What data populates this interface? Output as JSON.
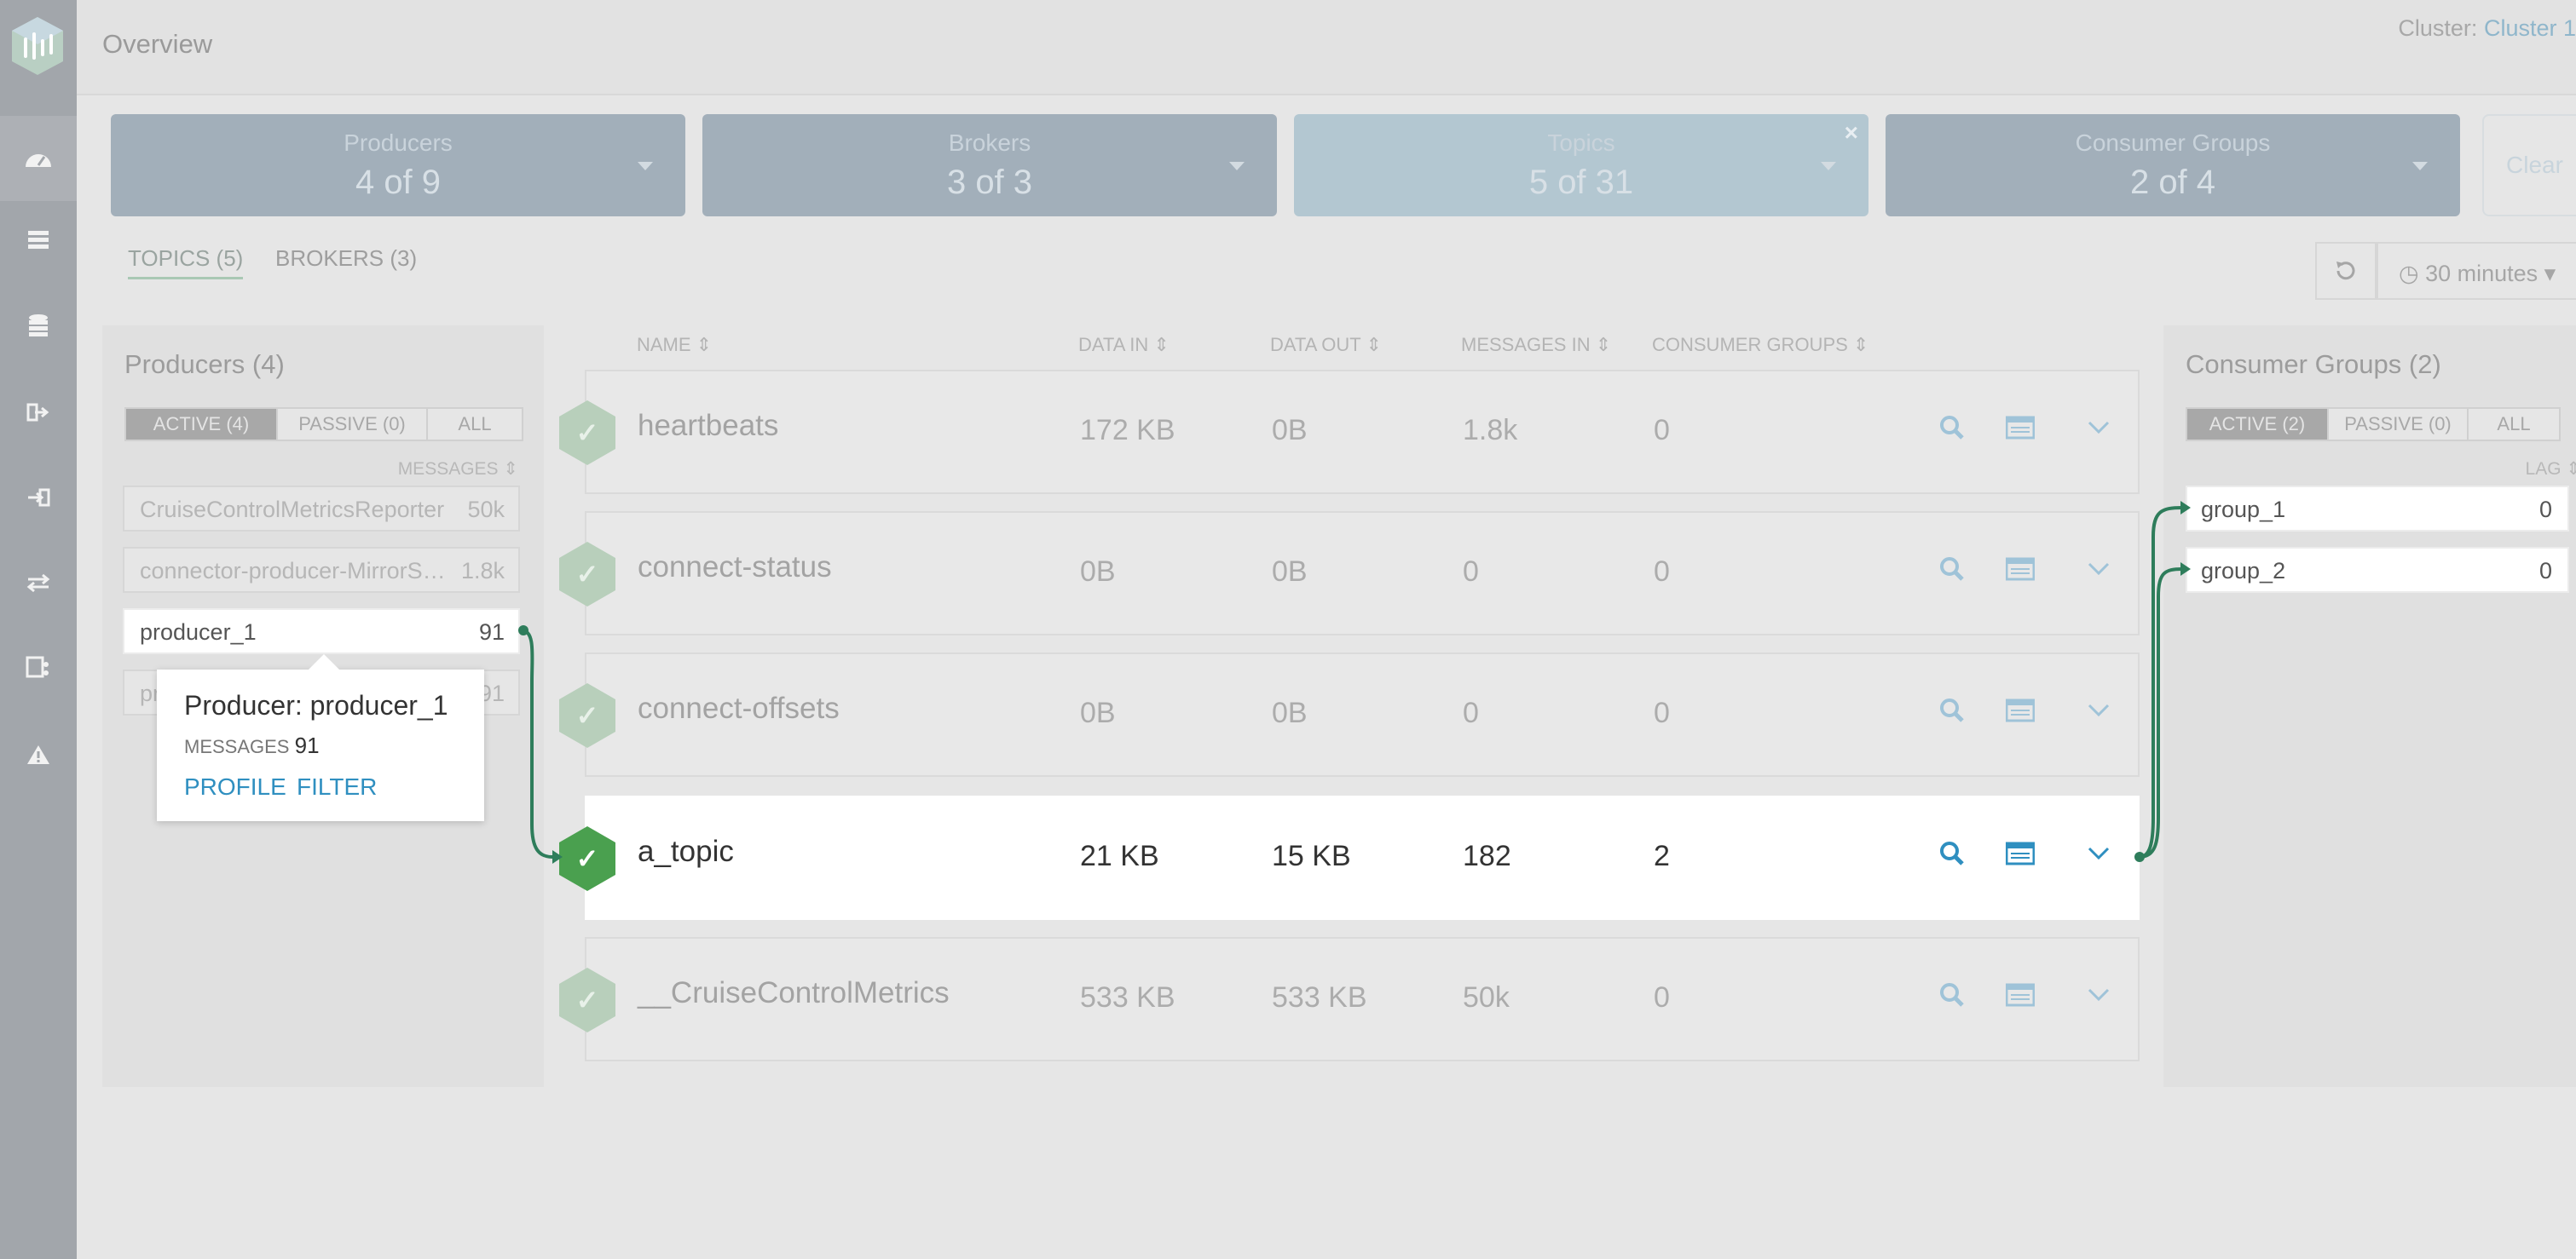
{
  "header": {
    "title": "Overview",
    "cluster_label": "Cluster:",
    "cluster_value": "Cluster 1"
  },
  "summary": {
    "producers": {
      "label": "Producers",
      "value": "4 of 9"
    },
    "brokers": {
      "label": "Brokers",
      "value": "3 of 3"
    },
    "topics": {
      "label": "Topics",
      "value": "5 of 31",
      "close": "×"
    },
    "consumer_groups": {
      "label": "Consumer Groups",
      "value": "2 of 4"
    },
    "clear_label": "Clear"
  },
  "tabs": {
    "topics": "TOPICS (5)",
    "brokers": "BROKERS (3)"
  },
  "time_range": "30 minutes",
  "producers_panel": {
    "title": "Producers (4)",
    "filters": [
      "ACTIVE (4)",
      "PASSIVE (0)",
      "ALL"
    ],
    "sort_label": "MESSAGES",
    "rows": [
      {
        "name": "CruiseControlMetricsReporter",
        "count": "50k"
      },
      {
        "name": "connector-producer-MirrorSourceConnector",
        "count": "1.8k"
      },
      {
        "name": "producer_1",
        "count": "91"
      },
      {
        "name": "producer_2",
        "count": "91"
      }
    ]
  },
  "topics_table": {
    "columns": [
      "NAME",
      "DATA IN",
      "DATA OUT",
      "MESSAGES IN",
      "CONSUMER GROUPS"
    ],
    "rows": [
      {
        "name": "heartbeats",
        "data_in": "172 KB",
        "data_out": "0B",
        "messages_in": "1.8k",
        "consumer_groups": "0"
      },
      {
        "name": "connect-status",
        "data_in": "0B",
        "data_out": "0B",
        "messages_in": "0",
        "consumer_groups": "0"
      },
      {
        "name": "connect-offsets",
        "data_in": "0B",
        "data_out": "0B",
        "messages_in": "0",
        "consumer_groups": "0"
      },
      {
        "name": "a_topic",
        "data_in": "21 KB",
        "data_out": "15 KB",
        "messages_in": "182",
        "consumer_groups": "2"
      },
      {
        "name": "__CruiseControlMetrics",
        "data_in": "533 KB",
        "data_out": "533 KB",
        "messages_in": "50k",
        "consumer_groups": "0"
      }
    ]
  },
  "consumers_panel": {
    "title": "Consumer Groups (2)",
    "filters": [
      "ACTIVE (2)",
      "PASSIVE (0)",
      "ALL"
    ],
    "sort_label": "LAG",
    "rows": [
      {
        "name": "group_1",
        "lag": "0"
      },
      {
        "name": "group_2",
        "lag": "0"
      }
    ]
  },
  "popover": {
    "title": "Producer: producer_1",
    "messages_label": "MESSAGES",
    "messages_value": "91",
    "profile_link": "PROFILE",
    "filter_link": "FILTER"
  },
  "colors": {
    "accent": "#2f8fc0",
    "topic_ok": "#4aa04f",
    "connector": "#2e7d5b"
  }
}
